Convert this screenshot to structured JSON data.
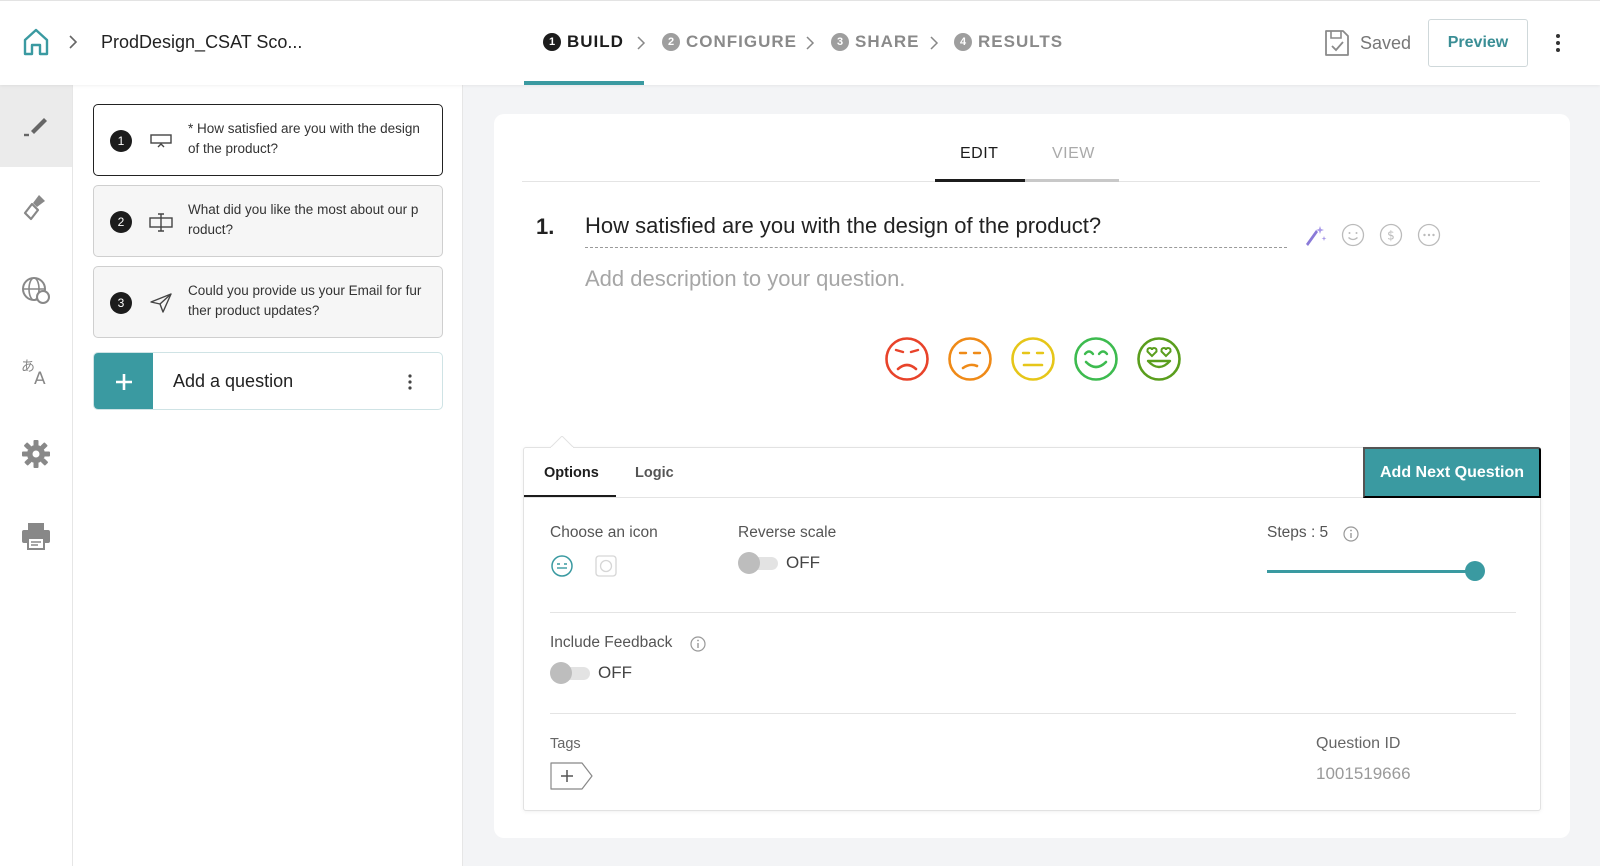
{
  "header": {
    "survey_title": "ProdDesign_CSAT Sco...",
    "steps": [
      {
        "num": "1",
        "label": "BUILD",
        "active": true
      },
      {
        "num": "2",
        "label": "CONFIGURE",
        "active": false
      },
      {
        "num": "3",
        "label": "SHARE",
        "active": false
      },
      {
        "num": "4",
        "label": "RESULTS",
        "active": false
      }
    ],
    "saved_label": "Saved",
    "preview_label": "Preview"
  },
  "rail": {
    "items": [
      {
        "icon": "pen-edit-icon",
        "active": true
      },
      {
        "icon": "paint-brush-icon",
        "active": false
      },
      {
        "icon": "globe-icon",
        "active": false
      },
      {
        "icon": "translate-icon",
        "active": false
      },
      {
        "icon": "gear-icon",
        "active": false
      },
      {
        "icon": "printer-icon",
        "active": false
      }
    ]
  },
  "questions": [
    {
      "num": "1",
      "text": "* How satisfied are you with the design of the product?",
      "type_icon": "rating-scale-icon",
      "selected": true
    },
    {
      "num": "2",
      "text": "What did you like the most about our p roduct?",
      "type_icon": "text-input-icon",
      "selected": false
    },
    {
      "num": "3",
      "text": "Could you provide us your Email for fur ther product updates?",
      "type_icon": "send-icon",
      "selected": false
    }
  ],
  "add_question_label": "Add a question",
  "editor": {
    "tabs": {
      "edit": "EDIT",
      "view": "VIEW"
    },
    "question_number": "1.",
    "question_title": "How satisfied are you with the design of the product?",
    "description_placeholder": "Add description to your question.",
    "faces": [
      {
        "icon": "very-dissatisfied-face-icon",
        "color": "#e8432a"
      },
      {
        "icon": "dissatisfied-face-icon",
        "color": "#ef8a17"
      },
      {
        "icon": "neutral-face-icon",
        "color": "#e6c619"
      },
      {
        "icon": "satisfied-face-icon",
        "color": "#3dbb4f"
      },
      {
        "icon": "very-satisfied-face-icon",
        "color": "#5a9e1d"
      }
    ]
  },
  "options": {
    "tab_options": "Options",
    "tab_logic": "Logic",
    "add_next_label": "Add Next Question",
    "choose_icon_label": "Choose an icon",
    "reverse_scale_label": "Reverse scale",
    "reverse_scale_state": "OFF",
    "steps_label": "Steps : 5",
    "steps_value": 5,
    "include_feedback_label": "Include Feedback",
    "include_feedback_state": "OFF",
    "tags_label": "Tags",
    "question_id_label": "Question ID",
    "question_id_value": "1001519666"
  },
  "colors": {
    "accent": "#3a9aa1",
    "dark": "#1c1c1c"
  }
}
